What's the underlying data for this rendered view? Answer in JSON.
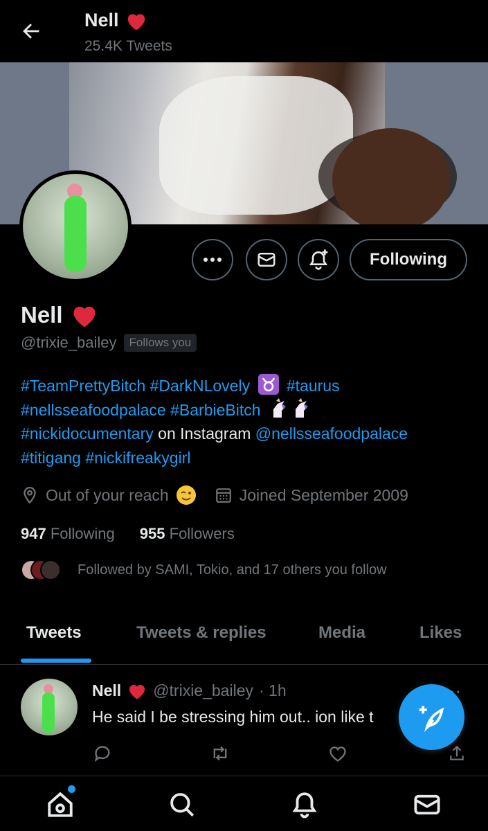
{
  "header": {
    "title": "Nell",
    "tweet_count": "25.4K Tweets"
  },
  "profile": {
    "name": "Nell",
    "handle": "@trixie_bailey",
    "follows_you": "Follows you",
    "follow_button": "Following",
    "bio": {
      "line1_a": "#TeamPrettyBitch #DarkNLovely",
      "line1_b": "#taurus",
      "line2": "#nellsseafoodpalace #BarbieBitch",
      "line3_a": "#nickidocumentary",
      "line3_b": " on Instagram ",
      "line3_c": "@nellsseafoodpalace",
      "line4": "#titigang #nickifreakygirl"
    },
    "location": "Out of your reach",
    "joined": "Joined September 2009",
    "following_count": "947",
    "following_label": "Following",
    "followers_count": "955",
    "followers_label": "Followers",
    "followed_by": "Followed by SAMI, Tokio, and 17 others you follow"
  },
  "tabs": [
    {
      "label": "Tweets",
      "active": true
    },
    {
      "label": "Tweets & replies",
      "active": false
    },
    {
      "label": "Media",
      "active": false
    },
    {
      "label": "Likes",
      "active": false
    }
  ],
  "tweet": {
    "name": "Nell",
    "handle": "@trixie_bailey",
    "time": "· 1h",
    "text": "He said I be stressing him out.. ion like t",
    "more": "···"
  },
  "colors": {
    "accent": "#1d9bf0",
    "background": "#000000",
    "muted": "#71767b",
    "heart": "#f4212e"
  }
}
